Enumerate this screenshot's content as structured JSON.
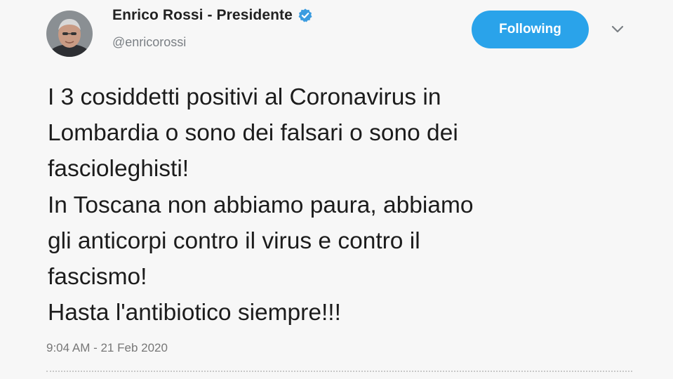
{
  "author": {
    "display_name": "Enrico Rossi - Presidente",
    "handle": "@enricorossi",
    "verified_icon": "verified-badge-icon",
    "avatar_icon": "profile-photo"
  },
  "follow_button": {
    "label": "Following",
    "color": "#2aa3ea"
  },
  "menu_icon": "chevron-down-icon",
  "tweet": {
    "lines": [
      "I 3 cosiddetti positivi al Coronavirus in",
      "Lombardia o sono dei falsari o sono dei",
      "fascioleghisti!",
      "In Toscana non abbiamo paura, abbiamo",
      "gli anticorpi contro il virus e contro il",
      "fascismo!",
      "Hasta l'antibiotico siempre!!!"
    ],
    "timestamp": "9:04 AM - 21 Feb 2020"
  }
}
